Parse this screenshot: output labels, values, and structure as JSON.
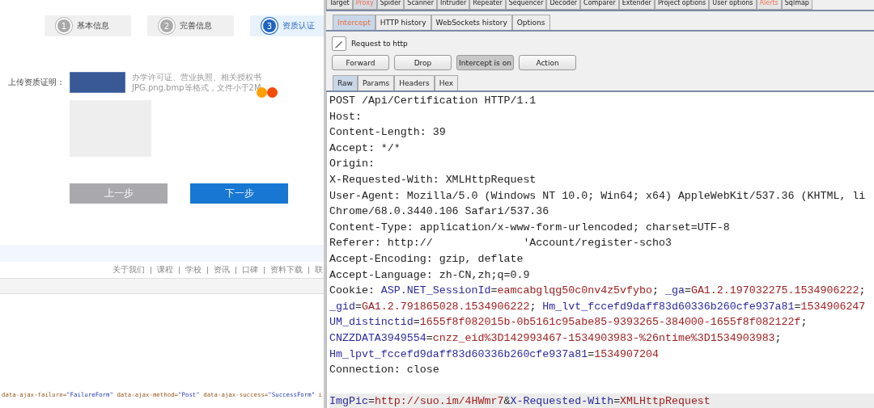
{
  "left_page": {
    "steps": [
      {
        "number": "1",
        "label": "基本信息",
        "selected": false
      },
      {
        "number": "2",
        "label": "完善信息",
        "selected": false
      },
      {
        "number": "3",
        "label": "资质认证",
        "selected": true
      }
    ],
    "upload": {
      "label": "上传资质证明：",
      "hint_lines": [
        "办学许可证、营业执照、相关授权书",
        "JPG.png.bmp等格式，文件小于2M"
      ]
    },
    "buttons": [
      {
        "label": "上一步",
        "disabled": true
      },
      {
        "label": "下一步",
        "disabled": false
      }
    ],
    "footer_links": [
      "关于我们",
      "课程",
      "学校",
      "资讯",
      "口碑",
      "资料下载",
      "联"
    ],
    "source_code": [
      {
        "text": "data-ajax-failure=",
        "kind": "attr"
      },
      {
        "text": "\"FailureForm\"",
        "kind": "value"
      },
      {
        "text": " data-ajax-method=",
        "kind": "attr"
      },
      {
        "text": "\"Post\"",
        "kind": "value"
      },
      {
        "text": " data-ajax-success=",
        "kind": "attr"
      },
      {
        "text": "\"SuccessForm\"",
        "kind": "value"
      },
      {
        "text": " i",
        "kind": "attr"
      }
    ]
  },
  "burp": {
    "tabs": [
      {
        "label": "Target",
        "selected": false,
        "alert": false
      },
      {
        "label": "Proxy",
        "selected": true,
        "alert": true
      },
      {
        "label": "Spider",
        "selected": false,
        "alert": false
      },
      {
        "label": "Scanner",
        "selected": false,
        "alert": false
      },
      {
        "label": "Intruder",
        "selected": false,
        "alert": false
      },
      {
        "label": "Repeater",
        "selected": false,
        "alert": false
      },
      {
        "label": "Sequencer",
        "selected": false,
        "alert": false
      },
      {
        "label": "Decoder",
        "selected": false,
        "alert": false
      },
      {
        "label": "Comparer",
        "selected": false,
        "alert": false
      },
      {
        "label": "Extender",
        "selected": false,
        "alert": false
      },
      {
        "label": "Project options",
        "selected": false,
        "alert": false
      },
      {
        "label": "User options",
        "selected": false,
        "alert": false
      },
      {
        "label": "Alerts",
        "selected": false,
        "alert": true
      },
      {
        "label": "Sqlmap",
        "selected": false,
        "alert": false
      }
    ],
    "proxy_tabs": [
      {
        "label": "Intercept",
        "selected": true
      },
      {
        "label": "HTTP history",
        "selected": false
      },
      {
        "label": "WebSockets history",
        "selected": false
      },
      {
        "label": "Options",
        "selected": false
      }
    ],
    "request_to": "Request to http",
    "buttons": [
      {
        "label": "Forward",
        "pressed": false
      },
      {
        "label": "Drop",
        "pressed": false
      },
      {
        "label": "Intercept is on",
        "pressed": true
      },
      {
        "label": "Action",
        "pressed": false
      }
    ],
    "editor_tabs": [
      {
        "label": "Raw",
        "selected": true
      },
      {
        "label": "Params",
        "selected": false
      },
      {
        "label": "Headers",
        "selected": false
      },
      {
        "label": "Hex",
        "selected": false
      }
    ],
    "request_lines": [
      {
        "highlighted": false,
        "segments": [
          {
            "text": "POST /Api/Certification HTTP/1.1",
            "kind": "plain"
          }
        ]
      },
      {
        "highlighted": false,
        "segments": [
          {
            "text": "Host:",
            "kind": "plain"
          }
        ]
      },
      {
        "highlighted": false,
        "segments": [
          {
            "text": "Content-Length: 39",
            "kind": "plain"
          }
        ]
      },
      {
        "highlighted": false,
        "segments": [
          {
            "text": "Accept: */*",
            "kind": "plain"
          }
        ]
      },
      {
        "highlighted": false,
        "segments": [
          {
            "text": "Origin:",
            "kind": "plain"
          }
        ]
      },
      {
        "highlighted": false,
        "segments": [
          {
            "text": "X-Requested-With: XMLHttpRequest",
            "kind": "plain"
          }
        ]
      },
      {
        "highlighted": false,
        "segments": [
          {
            "text": "User-Agent: Mozilla/5.0 (Windows NT 10.0; Win64; x64) AppleWebKit/537.36 (KHTML, li",
            "kind": "plain"
          }
        ]
      },
      {
        "highlighted": false,
        "segments": [
          {
            "text": "Chrome/68.0.3440.106 Safari/537.36",
            "kind": "plain"
          }
        ]
      },
      {
        "highlighted": false,
        "segments": [
          {
            "text": "Content-Type: application/x-www-form-urlencoded; charset=UTF-8",
            "kind": "plain"
          }
        ]
      },
      {
        "highlighted": false,
        "segments": [
          {
            "text": "Referer: http://              'Account/register-scho3",
            "kind": "plain"
          }
        ]
      },
      {
        "highlighted": false,
        "segments": [
          {
            "text": "Accept-Encoding: gzip, deflate",
            "kind": "plain"
          }
        ]
      },
      {
        "highlighted": false,
        "segments": [
          {
            "text": "Accept-Language: zh-CN,zh;q=0.9",
            "kind": "plain"
          }
        ]
      },
      {
        "highlighted": false,
        "segments": [
          {
            "text": "Cookie: ",
            "kind": "plain"
          },
          {
            "text": "ASP.NET_SessionId",
            "kind": "name"
          },
          {
            "text": "=",
            "kind": "plain"
          },
          {
            "text": "eamcabglqg50c0nv4z5vfybo",
            "kind": "value"
          },
          {
            "text": "; ",
            "kind": "plain"
          },
          {
            "text": "_ga",
            "kind": "name"
          },
          {
            "text": "=",
            "kind": "plain"
          },
          {
            "text": "GA1.2.197032275.1534906222",
            "kind": "value"
          },
          {
            "text": ";",
            "kind": "plain"
          }
        ]
      },
      {
        "highlighted": false,
        "segments": [
          {
            "text": "_gid",
            "kind": "name"
          },
          {
            "text": "=",
            "kind": "plain"
          },
          {
            "text": "GA1.2.791865028.1534906222",
            "kind": "value"
          },
          {
            "text": "; ",
            "kind": "plain"
          },
          {
            "text": "Hm_lvt_fccefd9daff83d60336b260cfe937a81",
            "kind": "name"
          },
          {
            "text": "=",
            "kind": "plain"
          },
          {
            "text": "1534906247",
            "kind": "value"
          }
        ]
      },
      {
        "highlighted": false,
        "segments": [
          {
            "text": "UM_distinctid",
            "kind": "name"
          },
          {
            "text": "=",
            "kind": "plain"
          },
          {
            "text": "1655f8f082015b-0b5161c95abe85-9393265-384000-1655f8f082122f",
            "kind": "value"
          },
          {
            "text": ";",
            "kind": "plain"
          }
        ]
      },
      {
        "highlighted": false,
        "segments": [
          {
            "text": "CNZZDATA3949554",
            "kind": "name"
          },
          {
            "text": "=",
            "kind": "plain"
          },
          {
            "text": "cnzz_eid%3D142993467-1534903983-%26ntime%3D1534903983",
            "kind": "value"
          },
          {
            "text": ";",
            "kind": "plain"
          }
        ]
      },
      {
        "highlighted": false,
        "segments": [
          {
            "text": "Hm_lpvt_fccefd9daff83d60336b260cfe937a81",
            "kind": "name"
          },
          {
            "text": "=",
            "kind": "plain"
          },
          {
            "text": "1534907204",
            "kind": "value"
          }
        ]
      },
      {
        "highlighted": false,
        "segments": [
          {
            "text": "Connection: close",
            "kind": "plain"
          }
        ]
      },
      {
        "highlighted": false
      },
      {
        "highlighted": true,
        "segments": [
          {
            "text": "ImgPic",
            "kind": "name"
          },
          {
            "text": "=",
            "kind": "plain"
          },
          {
            "text": "http://suo.im/4HWmr7",
            "kind": "value"
          },
          {
            "text": "&",
            "kind": "plain"
          },
          {
            "text": "X-Requested-With",
            "kind": "name"
          },
          {
            "text": "=",
            "kind": "plain"
          },
          {
            "text": "XMLHttpRequest",
            "kind": "value"
          }
        ]
      }
    ]
  }
}
